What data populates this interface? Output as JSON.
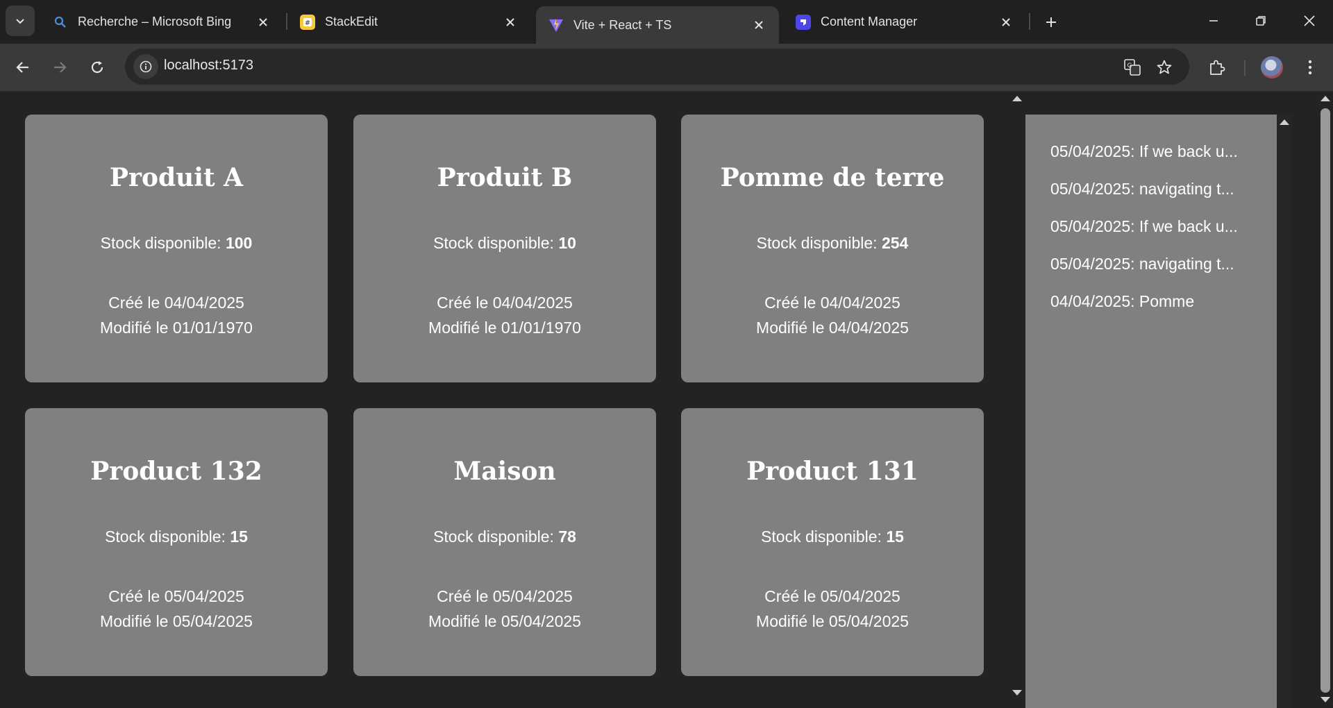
{
  "browser": {
    "tabs": [
      {
        "title": "Recherche – Microsoft Bing",
        "icon": "search-icon"
      },
      {
        "title": "StackEdit",
        "icon": "stackedit-icon"
      },
      {
        "title": "Vite + React + TS",
        "icon": "vite-icon",
        "active": true
      },
      {
        "title": "Content Manager",
        "icon": "content-manager-icon"
      }
    ],
    "url": "localhost:5173"
  },
  "products": [
    {
      "name": "Produit A",
      "stock_label": "Stock disponible:",
      "stock": "100",
      "created": "Créé le 04/04/2025",
      "modified": "Modifié le 01/01/1970"
    },
    {
      "name": "Produit B",
      "stock_label": "Stock disponible:",
      "stock": "10",
      "created": "Créé le 04/04/2025",
      "modified": "Modifié le 01/01/1970"
    },
    {
      "name": "Pomme de terre",
      "stock_label": "Stock disponible:",
      "stock": "254",
      "created": "Créé le 04/04/2025",
      "modified": "Modifié le 04/04/2025"
    },
    {
      "name": "Product 132",
      "stock_label": "Stock disponible:",
      "stock": "15",
      "created": "Créé le 05/04/2025",
      "modified": "Modifié le 05/04/2025"
    },
    {
      "name": "Maison",
      "stock_label": "Stock disponible:",
      "stock": "78",
      "created": "Créé le 05/04/2025",
      "modified": "Modifié le 05/04/2025"
    },
    {
      "name": "Product 131",
      "stock_label": "Stock disponible:",
      "stock": "15",
      "created": "Créé le 05/04/2025",
      "modified": "Modifié le 05/04/2025"
    }
  ],
  "activity_log": [
    "05/04/2025: If we back u...",
    "05/04/2025: navigating t...",
    "05/04/2025: If we back u...",
    "05/04/2025: navigating t...",
    "04/04/2025: Pomme"
  ],
  "colors": {
    "card_bg": "#808080",
    "page_bg": "#232323",
    "toolbar_bg": "#3a3a3a"
  }
}
